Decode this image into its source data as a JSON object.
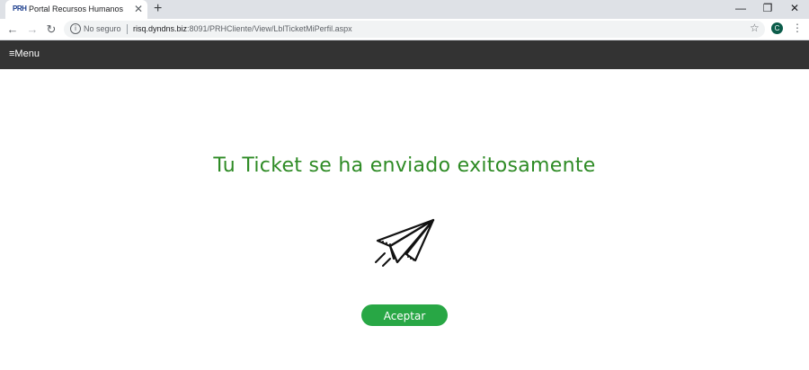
{
  "browser": {
    "tab": {
      "favicon_text": "PRH",
      "title": "Portal Recursos Humanos",
      "close": "✕"
    },
    "new_tab": "+",
    "window_controls": {
      "minimize": "—",
      "restore": "❐",
      "close": "✕"
    },
    "nav": {
      "back": "←",
      "forward": "→",
      "reload": "↻"
    },
    "omnibox": {
      "security_label": "No seguro",
      "url_host": "risq.dyndns.biz",
      "url_path": ":8091/PRHCliente/View/LblTicketMiPerfil.aspx"
    },
    "star": "☆",
    "profile_initial": "C",
    "menu_dots": "⋮"
  },
  "appbar": {
    "menu_label": "≡Menu"
  },
  "main": {
    "headline": "Tu Ticket se ha enviado exitosamente",
    "icon": "paper-plane-icon",
    "accept_label": "Aceptar"
  },
  "colors": {
    "headline": "#2e8b25",
    "accept_button": "#28a745",
    "appbar": "#333333"
  }
}
